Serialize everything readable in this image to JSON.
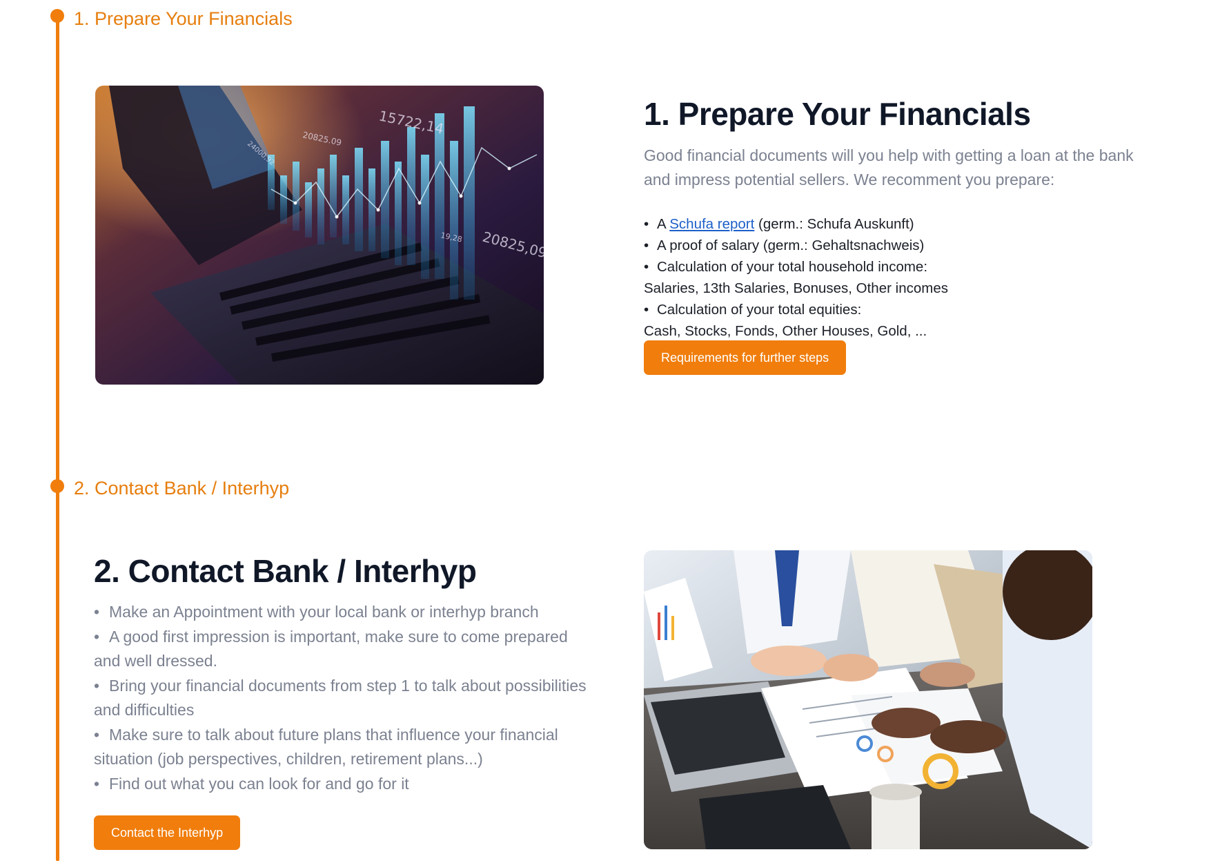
{
  "timeline": {
    "step1_label": "1. Prepare Your Financials",
    "step2_label": "2. Contact Bank / Interhyp"
  },
  "section1": {
    "heading": "1. Prepare Your Financials",
    "intro": "Good financial documents will you help with getting a loan at the bank and impress potential sellers. We recomment you prepare:",
    "items": {
      "schufa_prefix": "A ",
      "schufa_link": "Schufa report",
      "schufa_suffix": " (germ.: Schufa Auskunft)",
      "salary": "A proof of salary (germ.: Gehaltsnachweis)",
      "income": "Calculation of your total household income:",
      "income_detail": "Salaries, 13th Salaries, Bonuses, Other incomes",
      "equities": "Calculation of your total equities:",
      "equities_detail": "Cash, Stocks, Fonds, Other Houses, Gold, ..."
    },
    "button_label": "Requirements for further steps",
    "image_labels": [
      "15722,14",
      "20825.09",
      "20825,09",
      "19,28",
      "24000,92"
    ]
  },
  "section2": {
    "heading": "2. Contact Bank / Interhyp",
    "items": [
      "Make an Appointment with your local bank or interhyp branch",
      "A good first impression is important, make sure to come prepared and well dressed.",
      "Bring your financial documents from step 1 to talk about possibilities and difficulties",
      "Make sure to talk about future plans that influence your financial situation (job perspectives, children, retirement plans...)",
      "Find out what you can look for and go for it"
    ],
    "button_label": "Contact the Interhyp"
  },
  "colors": {
    "accent": "#f07d0c",
    "heading": "#101828",
    "muted_text": "#7b8190",
    "link": "#1d5fc8"
  }
}
